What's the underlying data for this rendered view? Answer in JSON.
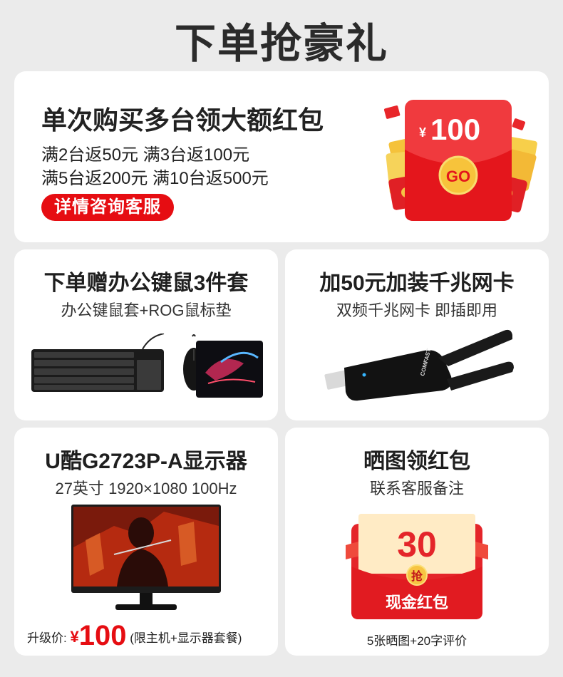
{
  "page": {
    "title": "下单抢豪礼"
  },
  "hero": {
    "title": "单次购买多台领大额红包",
    "line1": "满2台返50元 满3台返100元",
    "line2": "满5台返200元 满10台返500元",
    "button": "详情咨询客服",
    "redpack": {
      "currency": "¥",
      "amount": "100",
      "go": "GO"
    }
  },
  "cards": [
    {
      "title": "下单赠办公键鼠3件套",
      "subtitle": "办公键鼠套+ROG鼠标垫",
      "image": "keyboard-mouse-mousepad"
    },
    {
      "title": "加50元加装千兆网卡",
      "subtitle": "双频千兆网卡 即插即用",
      "image": "usb-wifi-adapter",
      "brand": "COMFAST"
    },
    {
      "title": "U酷G2723P-A显示器",
      "subtitle": "27英寸 1920×1080 100Hz",
      "image": "monitor",
      "price": {
        "prefix": "升级价:",
        "currency": "¥",
        "amount": "100",
        "suffix": "(限主机+显示器套餐)"
      }
    },
    {
      "title": "晒图领红包",
      "subtitle": "联系客服备注",
      "image": "cash-redpack",
      "redpack": {
        "amount": "30",
        "grab": "抢",
        "label": "现金红包"
      },
      "note": "5张晒图+20字评价"
    }
  ],
  "colors": {
    "accent": "#e60d12",
    "background": "#ebebeb",
    "card": "#ffffff"
  }
}
